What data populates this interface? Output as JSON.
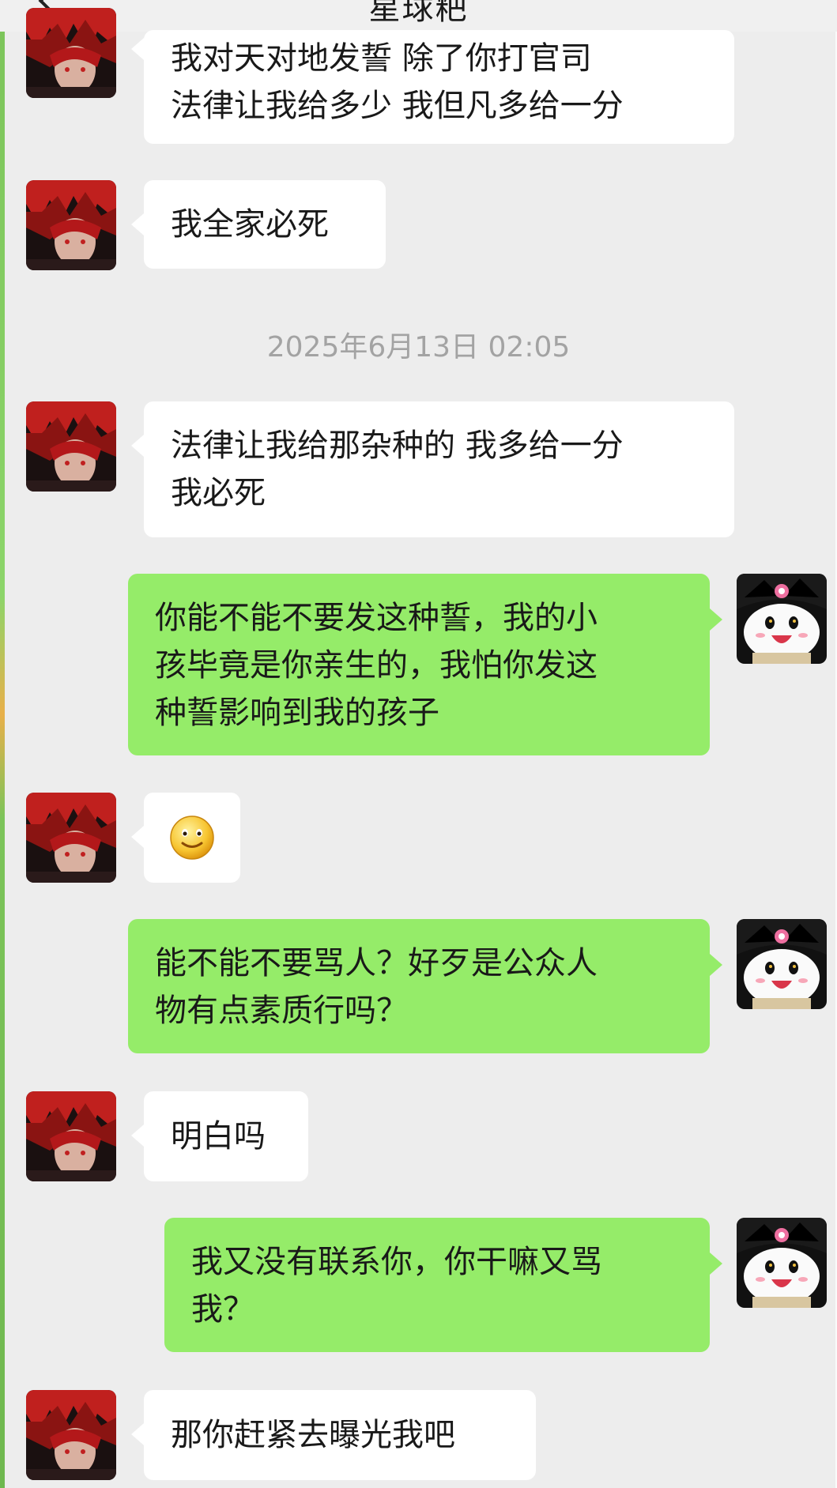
{
  "header": {
    "title": "星球粑",
    "back_icon": "back-chevron-icon"
  },
  "timestamp": "2025年6月13日 02:05",
  "colors": {
    "self_bubble": "#95ec69",
    "other_bubble": "#ffffff",
    "background": "#ededed"
  },
  "messages": [
    {
      "side": "left",
      "lines": [
        "我对天对地发誓 除了你打官司",
        "法律让我给多少 我但凡多给一分"
      ]
    },
    {
      "side": "left",
      "lines": [
        "我全家必死"
      ]
    },
    {
      "side": "left",
      "lines": [
        "法律让我给那杂种的 我多给一分",
        "我必死"
      ]
    },
    {
      "side": "right",
      "lines": [
        "你能不能不要发这种誓，我的小",
        "孩毕竟是你亲生的，我怕你发这",
        "种誓影响到我的孩子"
      ]
    },
    {
      "side": "left",
      "emoji": "smiley-emoji-icon"
    },
    {
      "side": "right",
      "lines": [
        "能不能不要骂人？好歹是公众人",
        "物有点素质行吗？"
      ]
    },
    {
      "side": "left",
      "lines": [
        "明白吗"
      ]
    },
    {
      "side": "right",
      "lines": [
        "我又没有联系你，你干嘛又骂",
        "我？"
      ]
    },
    {
      "side": "left",
      "lines": [
        "那你赶紧去曝光我吧"
      ]
    }
  ]
}
